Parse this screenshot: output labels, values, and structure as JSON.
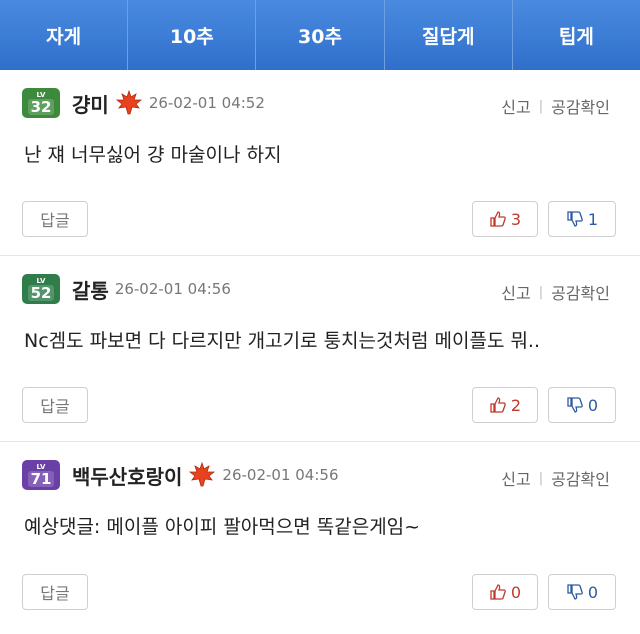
{
  "tabs": [
    "자게",
    "10추",
    "30추",
    "질답게",
    "팁게"
  ],
  "actions": {
    "report": "신고",
    "separator": "|",
    "likes": "공감확인"
  },
  "reply_label": "답글",
  "level_tag": "LV",
  "colors": {
    "tab_bar": "#3a7bd5",
    "like": "#c0392b",
    "dislike": "#2c5aa0"
  },
  "comments": [
    {
      "level": "32",
      "level_color": "#3d8a3d",
      "nick": "걍미",
      "badge": "maple-leaf",
      "time": "26-02-01 04:52",
      "body": "난 쟤 너무싫어 걍 마술이나 하지",
      "up": "3",
      "down": "1"
    },
    {
      "level": "52",
      "level_color": "#2f7d4a",
      "nick": "갈통",
      "badge": "",
      "time": "26-02-01 04:56",
      "body": "Nc겜도 파보면 다 다르지만 개고기로 퉁치는것처럼 메이플도 뭐..",
      "up": "2",
      "down": "0"
    },
    {
      "level": "71",
      "level_color": "#6a3fa6",
      "nick": "백두산호랑이",
      "badge": "maple-leaf",
      "time": "26-02-01 04:56",
      "body": "예상댓글: 메이플 아이피 팔아먹으면 똑같은게임~",
      "up": "0",
      "down": "0"
    }
  ]
}
